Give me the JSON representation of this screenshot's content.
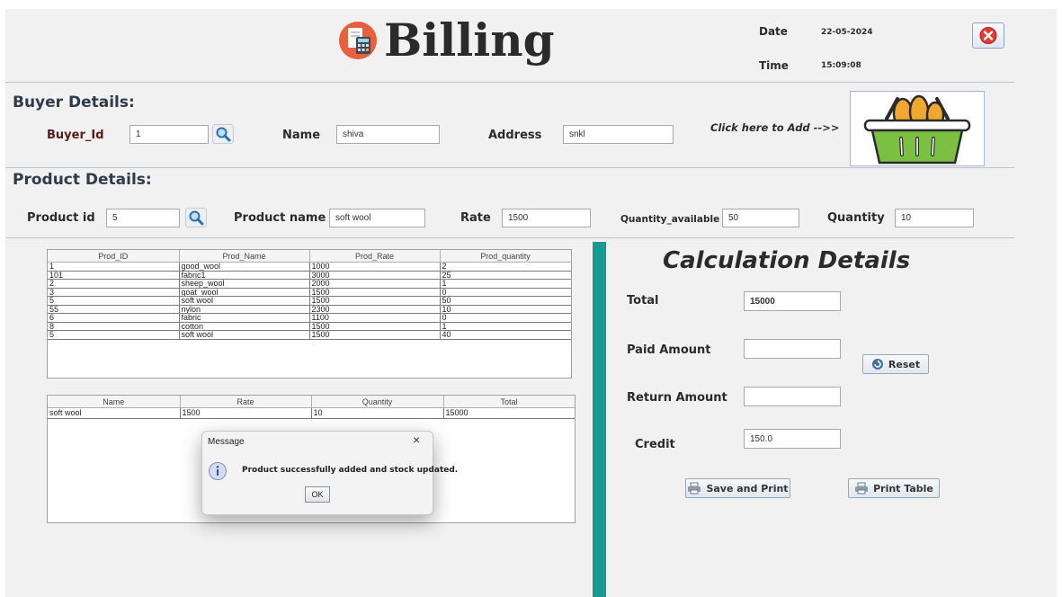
{
  "header": {
    "title": "Billing",
    "date_label": "Date",
    "date_value": "22-05-2024",
    "time_label": "Time",
    "time_value": "15:09:08"
  },
  "buyer": {
    "section_title": "Buyer Details:",
    "id_label": "Buyer_Id",
    "id_value": "1",
    "name_label": "Name",
    "name_value": "shiva",
    "address_label": "Address",
    "address_value": "snkl",
    "add_hint": "Click here to  Add -->>"
  },
  "product": {
    "section_title": "Product Details:",
    "id_label": "Product id",
    "id_value": "5",
    "name_label": "Product name",
    "name_value": "soft wool",
    "rate_label": "Rate",
    "rate_value": "1500",
    "qty_avail_label": "Quantity_available",
    "qty_avail_value": "50",
    "qty_label": "Quantity",
    "qty_value": "10"
  },
  "product_table": {
    "headers": [
      "Prod_ID",
      "Prod_Name",
      "Prod_Rate",
      "Prod_quantity"
    ],
    "rows": [
      [
        "1",
        "good_wool",
        "1000",
        "2"
      ],
      [
        "101",
        "fabric1",
        "3000",
        "25"
      ],
      [
        "2",
        "sheep_wool",
        "2000",
        "1"
      ],
      [
        "3",
        "goat_wool",
        "1500",
        "0"
      ],
      [
        "5",
        "soft wool",
        "1500",
        "50"
      ],
      [
        "55",
        "nylon",
        "2300",
        "10"
      ],
      [
        "6",
        "fabric",
        "1100",
        "0"
      ],
      [
        "8",
        "cotton",
        "1500",
        "1"
      ],
      [
        "5",
        "soft wool",
        "1500",
        "40"
      ]
    ]
  },
  "bill_table": {
    "headers": [
      "Name",
      "Rate",
      "Quantity",
      "Total"
    ],
    "rows": [
      [
        "soft wool",
        "1500",
        "10",
        "15000"
      ]
    ]
  },
  "calc": {
    "title": "Calculation Details",
    "total_label": "Total",
    "total_value": "15000",
    "paid_label": "Paid Amount",
    "paid_value": "",
    "reset_label": "Reset",
    "return_label": "Return Amount",
    "return_value": "",
    "credit_label": "Credit",
    "credit_value": "150.0",
    "save_print_label": "Save and Print",
    "print_table_label": "Print Table"
  },
  "dialog": {
    "title": "Message",
    "message": "Product successfully added and stock updated.",
    "ok_label": "OK",
    "close_glyph": "×"
  },
  "colors": {
    "divider": "#1a9a92",
    "close_button": "#e53935",
    "basket_green": "#7bc043"
  }
}
